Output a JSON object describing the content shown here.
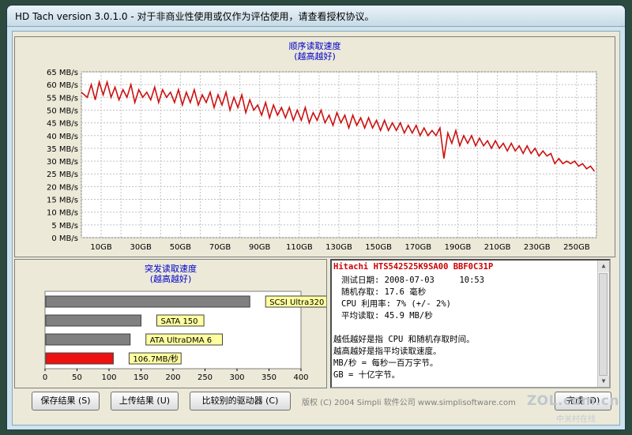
{
  "window": {
    "title": "HD Tach version 3.0.1.0 - 对于非商业性使用或仅作为评估使用，请查看授权协议。"
  },
  "seq_chart": {
    "title": "顺序读取速度",
    "subtitle": "(越高越好)"
  },
  "burst_chart": {
    "title": "突发读取速度",
    "subtitle": "(越高越好)"
  },
  "chart_data": [
    {
      "type": "line",
      "title": "顺序读取速度",
      "subtitle": "(越高越好)",
      "x_unit": "GB",
      "xlim": [
        0,
        260
      ],
      "ylim": [
        0,
        65
      ],
      "yticks": [
        "0 MB/s",
        "5 MB/s",
        "10 MB/s",
        "15 MB/s",
        "20 MB/s",
        "25 MB/s",
        "30 MB/s",
        "35 MB/s",
        "40 MB/s",
        "45 MB/s",
        "50 MB/s",
        "55 MB/s",
        "60 MB/s",
        "65 MB/s"
      ],
      "xticks": [
        "10GB",
        "30GB",
        "50GB",
        "70GB",
        "90GB",
        "110GB",
        "130GB",
        "150GB",
        "170GB",
        "190GB",
        "210GB",
        "230GB",
        "250GB"
      ],
      "grid": true,
      "color": "#cc1111",
      "series": [
        {
          "x": [
            0,
            3,
            5,
            7,
            9,
            11,
            13,
            15,
            17,
            19,
            21,
            23,
            25,
            27,
            29,
            31,
            33,
            35,
            37,
            39,
            41,
            43,
            45,
            47,
            49,
            51,
            53,
            55,
            57,
            59,
            61,
            63,
            65,
            67,
            69,
            71,
            73,
            75,
            77,
            79,
            81,
            83,
            85,
            87,
            89,
            91,
            93,
            95,
            97,
            99,
            101,
            103,
            105,
            107,
            109,
            111,
            113,
            115,
            117,
            119,
            121,
            123,
            125,
            127,
            129,
            131,
            133,
            135,
            137,
            139,
            141,
            143,
            145,
            147,
            149,
            151,
            153,
            155,
            157,
            159,
            161,
            163,
            165,
            167,
            169,
            171,
            173,
            175,
            177,
            179,
            181,
            183,
            185,
            187,
            189,
            191,
            193,
            195,
            197,
            199,
            201,
            203,
            205,
            207,
            209,
            211,
            213,
            215,
            217,
            219,
            221,
            223,
            225,
            227,
            229,
            231,
            233,
            235,
            237,
            239,
            241,
            243,
            245,
            247,
            249,
            251,
            253,
            255,
            257,
            259
          ],
          "y": [
            57,
            55,
            60,
            54,
            61,
            56,
            61,
            55,
            59,
            54,
            58,
            55,
            60,
            53,
            58,
            55,
            57,
            54,
            59,
            53,
            58,
            55,
            57,
            53,
            58,
            52,
            57,
            53,
            58,
            52,
            56,
            53,
            57,
            51,
            56,
            52,
            57,
            50,
            55,
            51,
            56,
            49,
            54,
            50,
            52,
            48,
            53,
            47,
            52,
            48,
            51,
            47,
            51,
            46,
            50,
            46,
            51,
            45,
            49,
            46,
            50,
            45,
            48,
            44,
            49,
            45,
            48,
            43,
            48,
            44,
            47,
            43,
            47,
            43,
            46,
            42,
            46,
            42,
            45,
            42,
            45,
            41,
            44,
            41,
            44,
            40,
            43,
            40,
            42,
            40,
            43,
            31,
            41,
            37,
            42,
            36,
            40,
            37,
            40,
            36,
            39,
            36,
            38,
            35,
            38,
            35,
            37,
            34,
            37,
            34,
            36,
            33,
            36,
            33,
            35,
            32,
            34,
            32,
            33,
            29,
            31,
            29,
            30,
            29,
            30,
            28,
            29,
            27,
            28,
            26
          ]
        }
      ]
    },
    {
      "type": "bar",
      "title": "突发读取速度",
      "subtitle": "(越高越好)",
      "xlim": [
        0,
        400
      ],
      "xticks": [
        0,
        50,
        100,
        150,
        200,
        250,
        300,
        350,
        400
      ],
      "categories": [
        "SCSI Ultra320",
        "SATA 150",
        "ATA UltraDMA 6",
        "106.7MB/秒"
      ],
      "values": [
        320,
        150,
        133,
        106.7
      ],
      "colors": [
        "#808080",
        "#808080",
        "#808080",
        "#ee1111"
      ],
      "label_bg": "#ffffa0"
    }
  ],
  "info": {
    "drive": "Hitachi HTS542525K9SA00 BBF0C31P",
    "date_label": "测试日期: 2008-07-03     10:53",
    "random_access": "随机存取: 17.6 毫秒",
    "cpu_usage": "CPU 利用率: 7% (+/- 2%)",
    "avg_read": "平均读取: 45.9 MB/秒",
    "note1": "越低越好是指 CPU 和随机存取时间。",
    "note2": "越高越好是指平均读取速度。",
    "note3": "MB/秒 = 每秒一百万字节。",
    "note4": "GB = 十亿字节。"
  },
  "buttons": {
    "save": "保存结果 (S)",
    "upload": "上传结果 (U)",
    "compare": "比较别的驱动器 (C)",
    "done": "完成 (D)"
  },
  "footer": {
    "copyright": "版权 (C) 2004 Simpli 软件公司 www.simplisoftware.com",
    "watermark": "ZOL.com.cn",
    "watermark_sub": "中关村在线"
  }
}
